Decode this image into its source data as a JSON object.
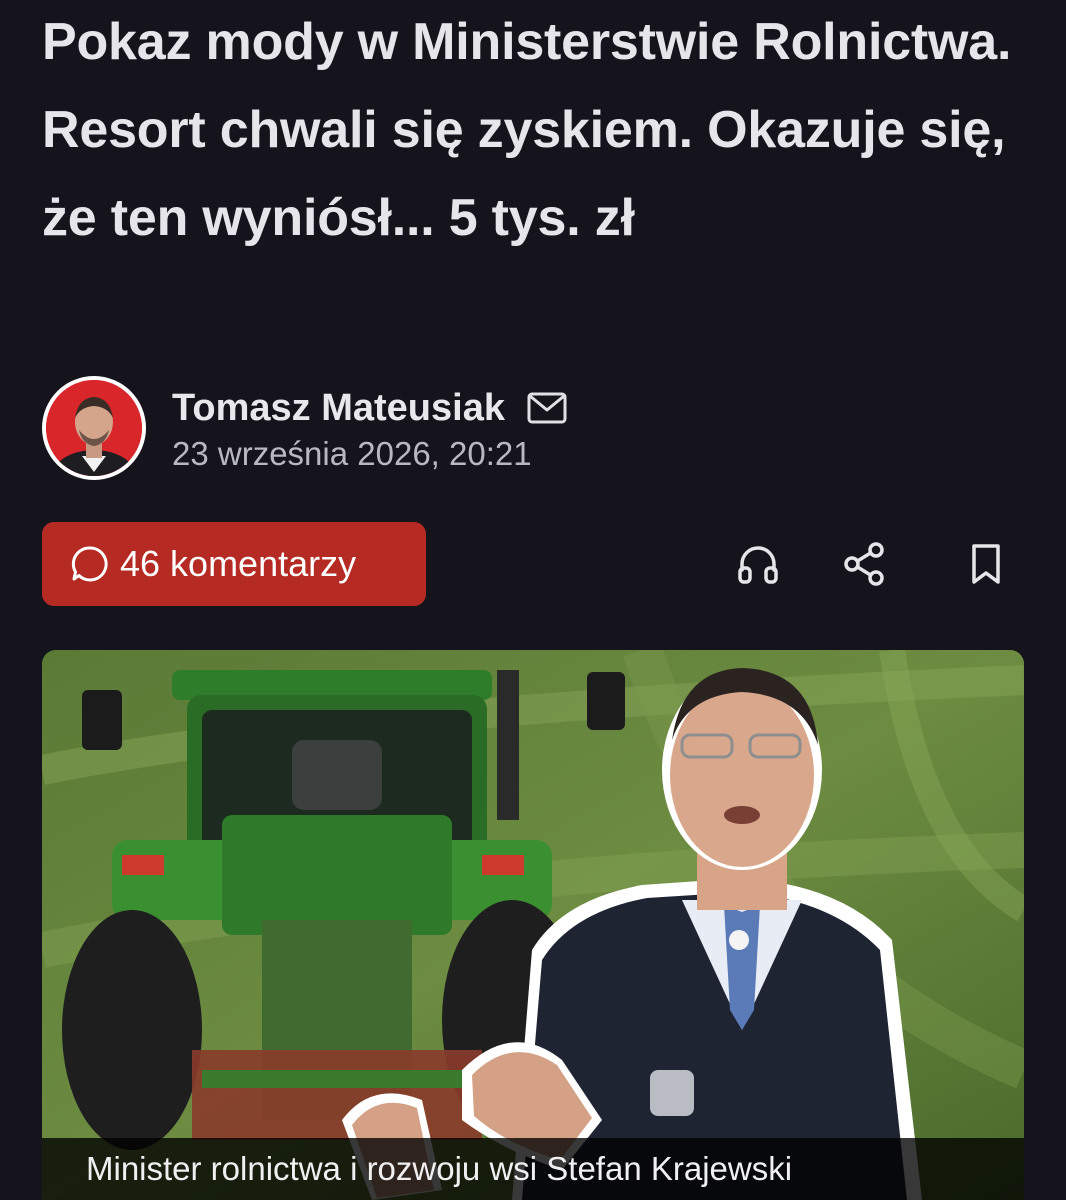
{
  "article": {
    "headline": "Pokaz mody w Ministerstwie Rolnictwa. Resort chwali się zyskiem. Okazuje się, że ten wyniósł... 5 tys. zł",
    "author": {
      "name": "Tomasz Mateusiak",
      "avatar_icon": "author-portrait",
      "contact_icon": "mail-icon"
    },
    "published": "23 września 2026, 20:21",
    "image_caption": "Minister rolnictwa i rozwoju wsi Stefan Krajewski"
  },
  "toolbar": {
    "comments_label": "46 komentarzy",
    "comments_icon": "comment-bubble-icon",
    "comments_color": "#b52a22",
    "actions": [
      {
        "name": "listen",
        "icon": "headphones-icon"
      },
      {
        "name": "share",
        "icon": "share-icon"
      },
      {
        "name": "bookmark",
        "icon": "bookmark-icon"
      }
    ]
  },
  "theme": {
    "background": "#15141c",
    "text": "#e6e6ea",
    "muted": "#b8b8c0"
  }
}
